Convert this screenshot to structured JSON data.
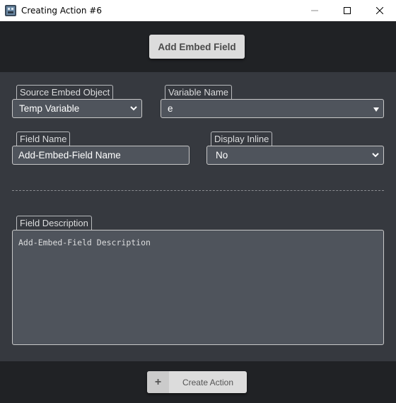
{
  "window": {
    "title": "Creating Action #6",
    "minimize_icon": "minimize-icon",
    "maximize_icon": "maximize-icon",
    "close_icon": "close-icon"
  },
  "header": {
    "add_button_label": "Add Embed Field"
  },
  "form": {
    "source_embed_object": {
      "label": "Source Embed Object",
      "value": "Temp Variable"
    },
    "variable_name": {
      "label": "Variable Name",
      "value": "e"
    },
    "field_name": {
      "label": "Field Name",
      "value": "Add-Embed-Field Name"
    },
    "display_inline": {
      "label": "Display Inline",
      "value": "No"
    },
    "field_description": {
      "label": "Field Description",
      "value": "Add-Embed-Field Description"
    }
  },
  "footer": {
    "create_button_label": "Create Action",
    "plus_icon": "plus-icon"
  },
  "colors": {
    "bar_background": "#202225",
    "body_background": "#36393f",
    "field_background": "#4f545c",
    "button_background": "#dcdcdc"
  }
}
